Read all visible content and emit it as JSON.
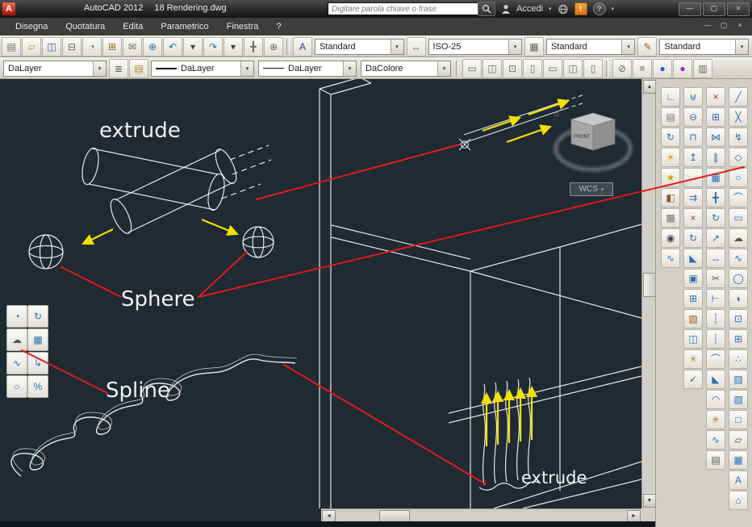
{
  "titlebar": {
    "app_letter": "A",
    "app_title": "AutoCAD 2012",
    "doc_title": "18 Rendering.dwg",
    "search_placeholder": "Digitare parola chiave o frase",
    "signin": "Accedi",
    "alert_glyph": "!",
    "help_glyph": "?",
    "caret": "▾",
    "win_min": "—",
    "win_max": "▢",
    "win_close": "×"
  },
  "menubar": {
    "items": [
      {
        "n": "menu-disegna",
        "label": "Disegna"
      },
      {
        "n": "menu-quotatura",
        "label": "Quotatura"
      },
      {
        "n": "menu-edita",
        "label": "Edita"
      },
      {
        "n": "menu-parametrico",
        "label": "Parametrico"
      },
      {
        "n": "menu-finestra",
        "label": "Finestra"
      },
      {
        "n": "menu-help",
        "label": "?"
      }
    ],
    "doc_min": "—",
    "doc_max": "▢",
    "doc_close": "×"
  },
  "toolbar1": {
    "left_icons": [
      {
        "n": "qnew-icon",
        "g": "▤",
        "c": "#6b6b6b"
      },
      {
        "n": "open-icon",
        "g": "▱",
        "c": "#c79a3b"
      },
      {
        "n": "save-icon",
        "g": "◫",
        "c": "#3a62a8"
      },
      {
        "n": "plot-icon",
        "g": "⊟",
        "c": "#666666"
      },
      {
        "n": "plot-preview-icon",
        "g": "◔",
        "c": "#666666"
      },
      {
        "n": "publish-icon",
        "g": "⊞",
        "c": "#8a6a2a"
      },
      {
        "n": "etransmit-icon",
        "g": "✉",
        "c": "#666666"
      },
      {
        "n": "hyperlink-icon",
        "g": "⊕",
        "c": "#2a6fb0"
      },
      {
        "n": "undo-icon",
        "g": "↶",
        "c": "#2a6fb0"
      },
      {
        "n": "undo-caret-icon",
        "g": "▾",
        "c": "#444444"
      },
      {
        "n": "redo-icon",
        "g": "↷",
        "c": "#2a6fb0"
      },
      {
        "n": "redo-caret-icon",
        "g": "▾",
        "c": "#444444"
      },
      {
        "n": "pan-icon",
        "g": "╋",
        "c": "#666666"
      },
      {
        "n": "zoom-icon",
        "g": "⊕",
        "c": "#666666"
      }
    ],
    "text_icons": [
      {
        "n": "text-style-icon",
        "g": "A",
        "c": "#1f3f8f"
      }
    ],
    "dim_icons": [
      {
        "n": "dim-style-icon",
        "g": "↔",
        "c": "#2a6fb0"
      }
    ],
    "table_icons": [
      {
        "n": "table-style-icon",
        "g": "▦",
        "c": "#666666"
      }
    ],
    "mleader_icons": [
      {
        "n": "mleader-style-icon",
        "g": "✎",
        "c": "#8a5a2a"
      }
    ],
    "text_style": "Standard",
    "dim_style": "ISO-25",
    "table_style": "Standard",
    "mleader_style": "Standard"
  },
  "toolbar2": {
    "color_value": "DaLayer",
    "linetype_value": "DaLayer",
    "lineweight_value": "DaLayer",
    "plotstyle_value": "DaColore",
    "left_icons": [
      {
        "n": "layer-properties-icon",
        "g": "≣",
        "c": "#666666"
      },
      {
        "n": "make-layer-current-icon",
        "g": "▤",
        "c": "#b08a2a"
      }
    ],
    "mid_icons": [
      {
        "n": "viewport-lock-icon",
        "g": "▭",
        "c": "#6b6b6b"
      },
      {
        "n": "annotation-scale-icon",
        "g": "◫",
        "c": "#6b6b6b"
      },
      {
        "n": "annotation-visibility-icon",
        "g": "⊡",
        "c": "#6b6b6b"
      },
      {
        "n": "autoscale-icon",
        "g": "▯",
        "c": "#6b6b6b"
      },
      {
        "n": "scale-list-icon",
        "g": "▭",
        "c": "#6b6b6b"
      },
      {
        "n": "viewport-icon",
        "g": "◫",
        "c": "#6b6b6b"
      },
      {
        "n": "page-setup-icon",
        "g": "▯",
        "c": "#6b6b6b"
      }
    ],
    "right_icons": [
      {
        "n": "no-plot-icon",
        "g": "⊘",
        "c": "#666666"
      },
      {
        "n": "lineweight-display-icon",
        "g": "≡",
        "c": "#666666"
      },
      {
        "n": "blue-marker-icon",
        "g": "●",
        "c": "#2b57cf"
      },
      {
        "n": "purple-marker-icon",
        "g": "●",
        "c": "#8a2bbf"
      },
      {
        "n": "sheet-icon",
        "g": "▥",
        "c": "#666666"
      }
    ]
  },
  "palette": {
    "tools": [
      {
        "n": "arc-tool-icon",
        "g": "◔",
        "c": "#2a6fb0"
      },
      {
        "n": "rotate-tool-icon",
        "g": "↻",
        "c": "#2a6fb0"
      },
      {
        "n": "revcloud-tool-icon",
        "g": "☁",
        "c": "#555555"
      },
      {
        "n": "table-tool-icon",
        "g": "▦",
        "c": "#2a6fb0"
      },
      {
        "n": "spline-tool-icon",
        "g": "∿",
        "c": "#2a6fb0"
      },
      {
        "n": "leader-tool-icon",
        "g": "↳",
        "c": "#2a6fb0"
      },
      {
        "n": "ellipse-tool-icon",
        "g": "○",
        "c": "#2a6fb0"
      },
      {
        "n": "divide-tool-icon",
        "g": "%",
        "c": "#2a6fb0"
      }
    ]
  },
  "rightbar": {
    "col1": [
      {
        "n": "ucs-icon",
        "g": "∟",
        "c": "#2a6fb0"
      },
      {
        "n": "named-views-icon",
        "g": "▤",
        "c": "#777777"
      },
      {
        "n": "orbit-3d-icon",
        "g": "↻",
        "c": "#2a6fb0"
      },
      {
        "n": "sun-light-icon",
        "g": "☀",
        "c": "#d8a200"
      },
      {
        "n": "spotlight-icon",
        "g": "★",
        "c": "#d8a200"
      },
      {
        "n": "materials-icon",
        "g": "◧",
        "c": "#8a5a2a"
      },
      {
        "n": "render-icon",
        "g": "▩",
        "c": "#777777"
      },
      {
        "n": "camera-icon",
        "g": "◉",
        "c": "#444444"
      },
      {
        "n": "motion-path-icon",
        "g": "∿",
        "c": "#2a6fb0"
      }
    ],
    "col2": [
      {
        "n": "union-icon",
        "g": "⊎",
        "c": "#2a6fb0"
      },
      {
        "n": "subtract-icon",
        "g": "⊖",
        "c": "#2a6fb0"
      },
      {
        "n": "intersect-icon",
        "g": "⊓",
        "c": "#2a6fb0"
      },
      {
        "n": "extrude-faces-icon",
        "g": "↥",
        "c": "#2a6fb0"
      },
      {
        "n": "move-faces-icon",
        "g": "↔",
        "c": "#2a6fb0"
      },
      {
        "n": "offset-faces-icon",
        "g": "⇉",
        "c": "#2a6fb0"
      },
      {
        "n": "delete-faces-icon",
        "g": "×",
        "c": "#b03030"
      },
      {
        "n": "rotate-faces-icon",
        "g": "↻",
        "c": "#2a6fb0"
      },
      {
        "n": "taper-faces-icon",
        "g": "◣",
        "c": "#2a6fb0"
      },
      {
        "n": "shell-icon",
        "g": "▣",
        "c": "#2a6fb0"
      },
      {
        "n": "copy-edges-icon",
        "g": "⊞",
        "c": "#2a6fb0"
      },
      {
        "n": "color-edges-icon",
        "g": "▨",
        "c": "#8a5a2a"
      },
      {
        "n": "imprint-icon",
        "g": "◫",
        "c": "#2a6fb0"
      },
      {
        "n": "clean-icon",
        "g": "✳",
        "c": "#b08030"
      },
      {
        "n": "check-icon",
        "g": "✓",
        "c": "#2a8a2a"
      }
    ],
    "col3": [
      {
        "n": "erase-icon",
        "g": "×",
        "c": "#b03030"
      },
      {
        "n": "copy-icon",
        "g": "⊞",
        "c": "#2a6fb0"
      },
      {
        "n": "mirror-icon",
        "g": "⋈",
        "c": "#2a6fb0"
      },
      {
        "n": "offset-icon",
        "g": "∥",
        "c": "#2a6fb0"
      },
      {
        "n": "array-icon",
        "g": "▦",
        "c": "#2a6fb0"
      },
      {
        "n": "move-icon",
        "g": "╋",
        "c": "#2a6fb0"
      },
      {
        "n": "rotate-icon",
        "g": "↻",
        "c": "#2a6fb0"
      },
      {
        "n": "scale-icon",
        "g": "↗",
        "c": "#2a6fb0"
      },
      {
        "n": "stretch-icon",
        "g": "↔",
        "c": "#2a6fb0"
      },
      {
        "n": "trim-icon",
        "g": "✂",
        "c": "#555555"
      },
      {
        "n": "extend-icon",
        "g": "⊢",
        "c": "#2a6fb0"
      },
      {
        "n": "break-point-icon",
        "g": "┆",
        "c": "#2a6fb0"
      },
      {
        "n": "break-icon",
        "g": "┊",
        "c": "#2a6fb0"
      },
      {
        "n": "join-icon",
        "g": "⌒",
        "c": "#2a6fb0"
      },
      {
        "n": "chamfer-icon",
        "g": "◣",
        "c": "#2a6fb0"
      },
      {
        "n": "fillet-icon",
        "g": "◠",
        "c": "#2a6fb0"
      },
      {
        "n": "explode-icon",
        "g": "✳",
        "c": "#b08030"
      },
      {
        "n": "blend-icon",
        "g": "∿",
        "c": "#2a6fb0"
      },
      {
        "n": "properties-icon",
        "g": "▤",
        "c": "#555555"
      }
    ],
    "col4": [
      {
        "n": "line-icon",
        "g": "╱",
        "c": "#2a6fb0"
      },
      {
        "n": "xline-icon",
        "g": "╳",
        "c": "#2a6fb0"
      },
      {
        "n": "polyline-icon",
        "g": "↯",
        "c": "#2a6fb0"
      },
      {
        "n": "polygon-icon",
        "g": "◇",
        "c": "#2a6fb0"
      },
      {
        "n": "circle-icon",
        "g": "○",
        "c": "#2a6fb0"
      },
      {
        "n": "arc-icon",
        "g": "⌒",
        "c": "#2a6fb0"
      },
      {
        "n": "rectangle-icon",
        "g": "▭",
        "c": "#2a6fb0"
      },
      {
        "n": "revcloud-icon",
        "g": "☁",
        "c": "#555555"
      },
      {
        "n": "spline-icon",
        "g": "∿",
        "c": "#2a6fb0"
      },
      {
        "n": "ellipse-icon",
        "g": "◯",
        "c": "#2a6fb0"
      },
      {
        "n": "ellipse-arc-icon",
        "g": "◖",
        "c": "#2a6fb0"
      },
      {
        "n": "insert-block-icon",
        "g": "⊡",
        "c": "#2a6fb0"
      },
      {
        "n": "make-block-icon",
        "g": "⊞",
        "c": "#2a6fb0"
      },
      {
        "n": "point-icon",
        "g": "∴",
        "c": "#2a6fb0"
      },
      {
        "n": "hatch-icon",
        "g": "▨",
        "c": "#2a6fb0"
      },
      {
        "n": "gradient-icon",
        "g": "▧",
        "c": "#2a6fb0"
      },
      {
        "n": "region-icon",
        "g": "□",
        "c": "#2a6fb0"
      },
      {
        "n": "wipeout-icon",
        "g": "▱",
        "c": "#555555"
      },
      {
        "n": "table-icon",
        "g": "▦",
        "c": "#2a6fb0"
      },
      {
        "n": "mtext-icon",
        "g": "A",
        "c": "#2a6fb0"
      },
      {
        "n": "3dpoly-icon",
        "g": "⌂",
        "c": "#2a6fb0"
      }
    ]
  },
  "drawing": {
    "background_color": "#1f2a33",
    "wire_color": "#e8e8e8",
    "annotation_color": "#e01b1b",
    "arrow_color": "#f0e100",
    "label_extrude_top": "extrude",
    "label_sphere": "Sphere",
    "label_spline": "Spline",
    "label_extrude_bottom": "extrude",
    "viewcube_wcs": "WCS",
    "viewcube_front": "FRONT",
    "viewcube_home": "⌂",
    "wcs_caret": "▾"
  },
  "scrollbars": {
    "up": "▲",
    "down": "▼",
    "left": "◄",
    "right": "►"
  }
}
